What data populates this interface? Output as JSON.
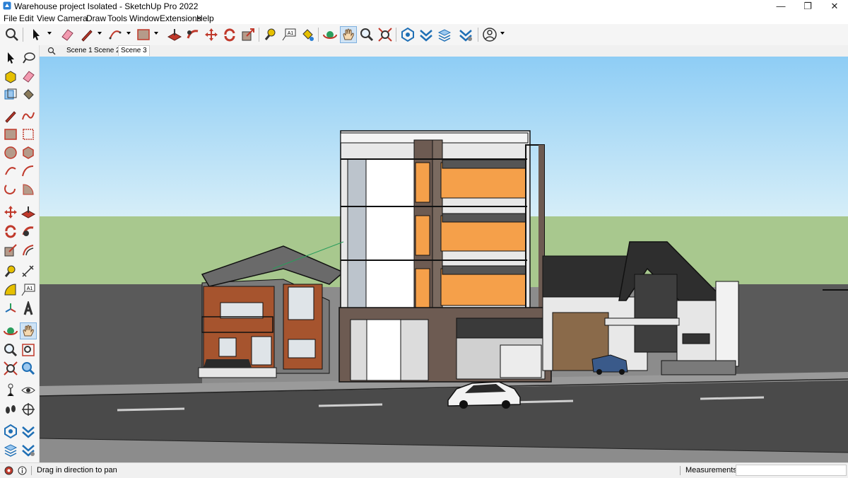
{
  "window": {
    "title": "Warehouse project Isolated - SketchUp Pro 2022",
    "minimize_glyph": "—",
    "restore_glyph": "❐",
    "close_glyph": "✕"
  },
  "menu": [
    "File",
    "Edit",
    "View",
    "Camera",
    "Draw",
    "Tools",
    "Window",
    "Extensions",
    "Help"
  ],
  "scenes": {
    "tabs": [
      "Scene 1",
      "Scene 2",
      "Scene 3"
    ],
    "active": "Scene 3"
  },
  "status": {
    "hint": "Drag in direction to pan",
    "measurements_label": "Measurements",
    "measurements_value": ""
  },
  "colors": {
    "sky_top": "#8ecdf5",
    "sky_bottom": "#d6eef8",
    "ground": "#a8c88e",
    "road": "#505050",
    "accent_orange": "#f5a04a",
    "brick": "#a6542e"
  }
}
